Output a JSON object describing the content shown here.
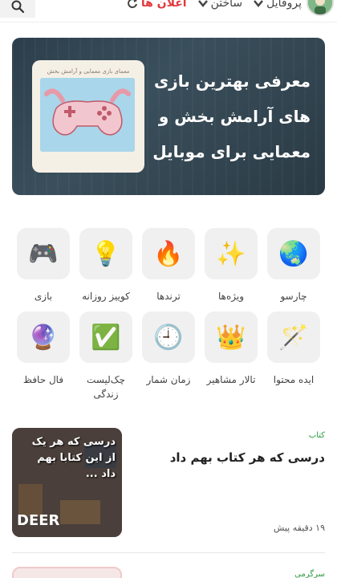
{
  "header": {
    "nav": [
      {
        "label": "پروفایل",
        "icon": "chevron-down-icon"
      },
      {
        "label": "ساختن",
        "icon": "chevron-down-icon"
      },
      {
        "label": "اعلان ها",
        "icon": "refresh-icon"
      }
    ]
  },
  "hero": {
    "title": "معرفی بهترین بازی های آرامش بخش و معمایی برای موبایل",
    "card_caption": "معمای بازی معمایی و آرامش بخش"
  },
  "categories": [
    {
      "label": "چارسو",
      "icon": "globe-icon",
      "glyph": "🌏"
    },
    {
      "label": "ویژه‌ها",
      "icon": "sparkles-icon",
      "glyph": "✨"
    },
    {
      "label": "ترندها",
      "icon": "fire-icon",
      "glyph": "🔥"
    },
    {
      "label": "کوییز روزانه",
      "icon": "lightbulb-icon",
      "glyph": "💡"
    },
    {
      "label": "بازی",
      "icon": "gamepad-icon",
      "glyph": "🎮"
    },
    {
      "label": "ایده محتوا",
      "icon": "magic-wand-icon",
      "glyph": "🪄"
    },
    {
      "label": "تالار مشاهیر",
      "icon": "crown-icon",
      "glyph": "👑"
    },
    {
      "label": "زمان شمار",
      "icon": "clock-icon",
      "glyph": "🕘"
    },
    {
      "label": "چک‌لیست زندگی",
      "icon": "checkmark-icon",
      "glyph": "✅"
    },
    {
      "label": "فال حافظ",
      "icon": "crystal-ball-icon",
      "glyph": "🔮"
    }
  ],
  "article": {
    "tag": "کتاب",
    "title": "درسی که هر کتاب بهم داد",
    "time": "۱۹ دقیقه پیش",
    "thumb_text": "درسی که هر یک از این کتابا بهم داد ...",
    "thumb_brand": "DEER"
  },
  "article2": {
    "tag": "سرگرمی"
  },
  "colors": {
    "accent_red": "#e0393e",
    "tag_green": "#2e9b45"
  }
}
